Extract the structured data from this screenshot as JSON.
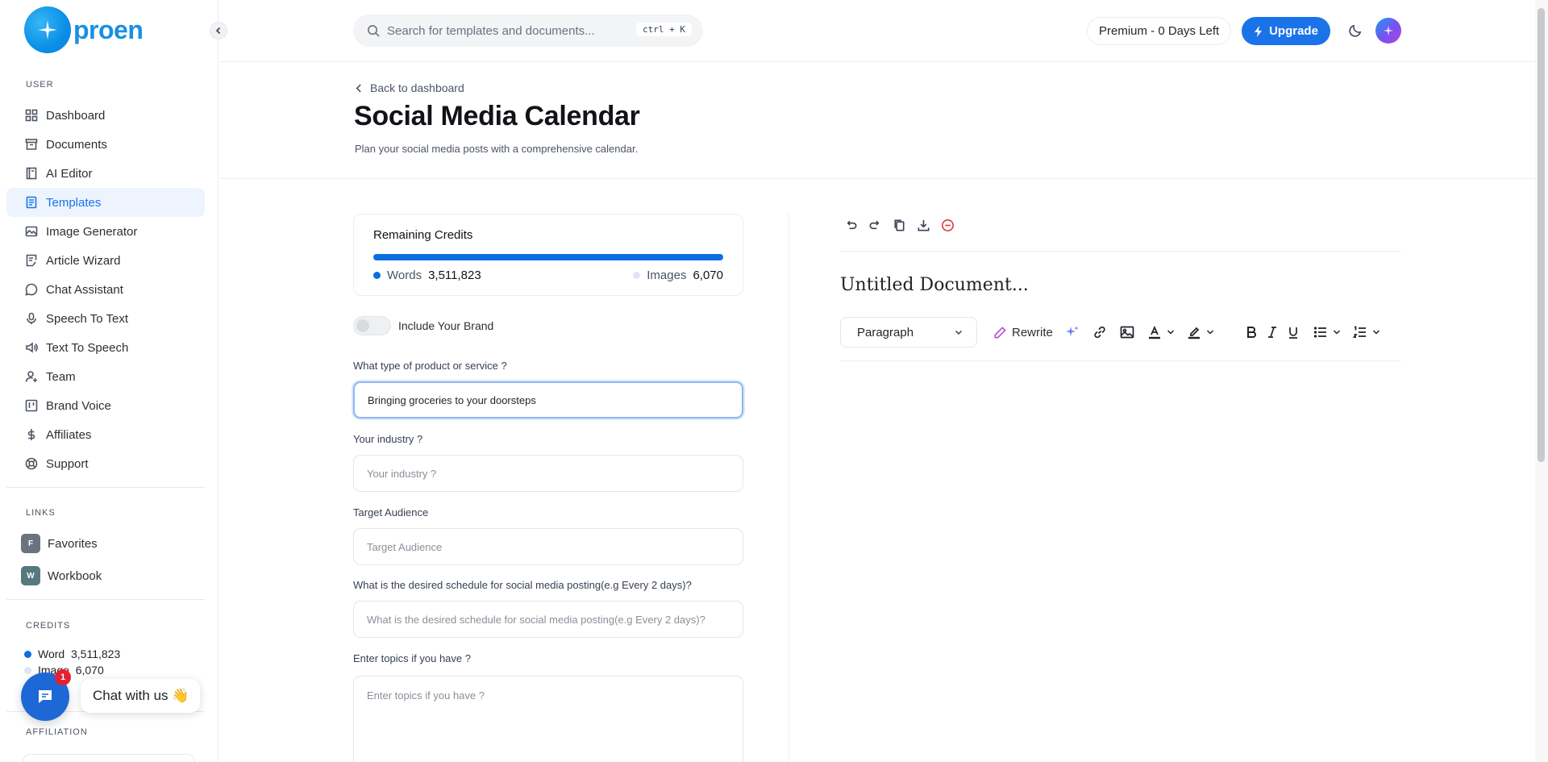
{
  "app": {
    "logo_text": "proen"
  },
  "sidebar": {
    "user_section": "USER",
    "items": [
      {
        "label": "Dashboard"
      },
      {
        "label": "Documents"
      },
      {
        "label": "AI Editor"
      },
      {
        "label": "Templates",
        "active": true
      },
      {
        "label": "Image Generator"
      },
      {
        "label": "Article Wizard"
      },
      {
        "label": "Chat Assistant"
      },
      {
        "label": "Speech To Text"
      },
      {
        "label": "Text To Speech"
      },
      {
        "label": "Team"
      },
      {
        "label": "Brand Voice"
      },
      {
        "label": "Affiliates"
      },
      {
        "label": "Support"
      }
    ],
    "links_section": "LINKS",
    "links": [
      {
        "badge": "F",
        "label": "Favorites",
        "color": "#6b7280"
      },
      {
        "badge": "W",
        "label": "Workbook",
        "color": "#547a80"
      }
    ],
    "credits_section": "CREDITS",
    "credits": {
      "word_label": "Word",
      "word_value": "3,511,823",
      "image_label": "Image",
      "image_value": "6,070"
    },
    "affiliation_section": "AFFILIATION"
  },
  "chat": {
    "label": "Chat with us 👋",
    "badge": "1"
  },
  "header": {
    "search_placeholder": "Search for templates and documents...",
    "shortcut": "ctrl + K",
    "premium": "Premium - 0 Days Left",
    "upgrade": "Upgrade"
  },
  "page": {
    "back": "Back to dashboard",
    "title": "Social Media Calendar",
    "subtitle": "Plan your social media posts with a comprehensive calendar."
  },
  "credits_card": {
    "title": "Remaining Credits",
    "words_label": "Words",
    "words_value": "3,511,823",
    "images_label": "Images",
    "images_value": "6,070",
    "words_color": "#0b6fe0",
    "images_color": "#dfe6f3",
    "words_fraction": 1.0
  },
  "form": {
    "brand_toggle": "Include Your Brand",
    "product_label": "What type of product or service ?",
    "product_value": "Bringing groceries to your doorsteps",
    "industry_label": "Your industry ?",
    "industry_placeholder": "Your industry ?",
    "audience_label": "Target Audience",
    "audience_placeholder": "Target Audience",
    "schedule_label": "What is the desired schedule for social media posting(e.g Every 2 days)?",
    "schedule_placeholder": "What is the desired schedule for social media posting(e.g Every 2 days)?",
    "topics_label": "Enter topics if you have ?",
    "topics_placeholder": "Enter topics if you have ?"
  },
  "editor": {
    "doc_title": "Untitled Document...",
    "paragraph": "Paragraph",
    "rewrite": "Rewrite"
  },
  "colors": {
    "accent": "#1a73e8",
    "logo": "#1a8fe3",
    "chat": "#1d68d6",
    "danger": "#e0393e"
  }
}
